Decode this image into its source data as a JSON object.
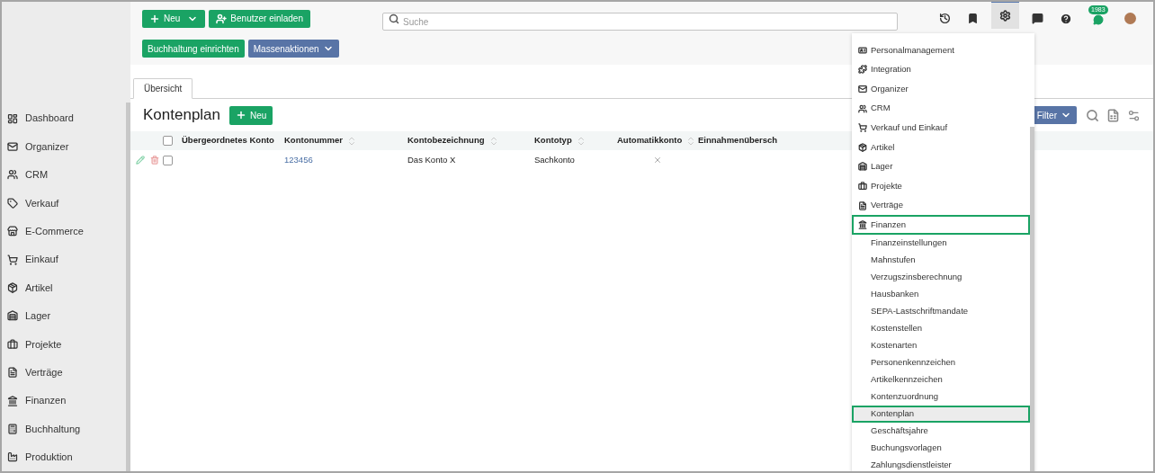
{
  "toolbar": {
    "new_button": "Neu",
    "invite_button": "Benutzer einladen",
    "search": {
      "placeholder": "Suche"
    },
    "setup_button": "Buchhaltung einrichten",
    "bulk_button": "Massenaktionen",
    "notifications_badge": "1983",
    "settings_active": true
  },
  "sidebar": {
    "items": [
      {
        "label": "Dashboard"
      },
      {
        "label": "Organizer"
      },
      {
        "label": "CRM"
      },
      {
        "label": "Verkauf"
      },
      {
        "label": "E-Commerce"
      },
      {
        "label": "Einkauf"
      },
      {
        "label": "Artikel"
      },
      {
        "label": "Lager"
      },
      {
        "label": "Projekte"
      },
      {
        "label": "Verträge"
      },
      {
        "label": "Finanzen"
      },
      {
        "label": "Buchhaltung"
      },
      {
        "label": "Produktion"
      }
    ]
  },
  "tabs": [
    {
      "label": "Übersicht",
      "selected": true
    }
  ],
  "page": {
    "title": "Kontenplan",
    "new_button": "Neu",
    "filter_button": "Filter"
  },
  "table": {
    "select_all": false,
    "columns": [
      {
        "label": "Übergeordnetes Konto",
        "sortable": false
      },
      {
        "label": "Kontonummer",
        "sortable": true
      },
      {
        "label": "Kontobezeichnung",
        "sortable": true
      },
      {
        "label": "Kontotyp",
        "sortable": true
      },
      {
        "label": "Automatikkonto",
        "sortable": true
      },
      {
        "label": "Einnahmenübersch",
        "sortable": false
      }
    ],
    "rows": [
      {
        "checked": false,
        "parent": "",
        "number": "123456",
        "name": "Das Konto X",
        "type": "Sachkonto",
        "automatic": false
      }
    ]
  },
  "settings_menu": {
    "items": [
      {
        "kind": "section",
        "label": "Personalmanagement",
        "highlighted": false,
        "selected": false
      },
      {
        "kind": "section",
        "label": "Integration",
        "highlighted": false,
        "selected": false
      },
      {
        "kind": "section",
        "label": "Organizer",
        "highlighted": false,
        "selected": false
      },
      {
        "kind": "section",
        "label": "CRM",
        "highlighted": false,
        "selected": false
      },
      {
        "kind": "section",
        "label": "Verkauf und Einkauf",
        "highlighted": false,
        "selected": false
      },
      {
        "kind": "section",
        "label": "Artikel",
        "highlighted": false,
        "selected": false
      },
      {
        "kind": "section",
        "label": "Lager",
        "highlighted": false,
        "selected": false
      },
      {
        "kind": "section",
        "label": "Projekte",
        "highlighted": false,
        "selected": false
      },
      {
        "kind": "section",
        "label": "Verträge",
        "highlighted": false,
        "selected": false
      },
      {
        "kind": "section",
        "label": "Finanzen",
        "highlighted": true,
        "selected": false
      },
      {
        "kind": "sub",
        "label": "Finanzeinstellungen",
        "highlighted": false,
        "selected": false
      },
      {
        "kind": "sub",
        "label": "Mahnstufen",
        "highlighted": false,
        "selected": false
      },
      {
        "kind": "sub",
        "label": "Verzugszinsberechnung",
        "highlighted": false,
        "selected": false
      },
      {
        "kind": "sub",
        "label": "Hausbanken",
        "highlighted": false,
        "selected": false
      },
      {
        "kind": "sub",
        "label": "SEPA-Lastschriftmandate",
        "highlighted": false,
        "selected": false
      },
      {
        "kind": "sub",
        "label": "Kostenstellen",
        "highlighted": false,
        "selected": false
      },
      {
        "kind": "sub",
        "label": "Kostenarten",
        "highlighted": false,
        "selected": false
      },
      {
        "kind": "sub",
        "label": "Personenkennzeichen",
        "highlighted": false,
        "selected": false
      },
      {
        "kind": "sub",
        "label": "Artikelkennzeichen",
        "highlighted": false,
        "selected": false
      },
      {
        "kind": "sub",
        "label": "Kontenzuordnung",
        "highlighted": false,
        "selected": false
      },
      {
        "kind": "sub",
        "label": "Kontenplan",
        "highlighted": true,
        "selected": true
      },
      {
        "kind": "sub",
        "label": "Geschäftsjahre",
        "highlighted": false,
        "selected": false
      },
      {
        "kind": "sub",
        "label": "Buchungsvorlagen",
        "highlighted": false,
        "selected": false
      },
      {
        "kind": "sub",
        "label": "Zahlungsdienstleister",
        "highlighted": false,
        "selected": false
      }
    ]
  }
}
